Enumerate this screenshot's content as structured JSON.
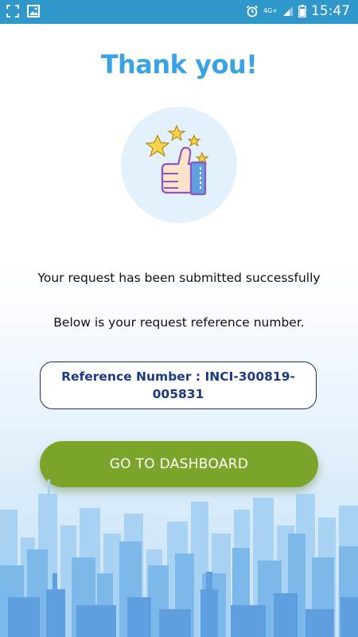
{
  "status_bar": {
    "time": "15:47",
    "network": "4G+",
    "left_icons": [
      "screenshot-icon",
      "image-icon"
    ],
    "right_icons": [
      "alarm-icon",
      "signal-icon",
      "battery-icon"
    ]
  },
  "page": {
    "title": "Thank you!",
    "hero_icon": "thumbs-up-stars-icon",
    "message_success": "Your request has been submitted successfully",
    "message_reference": "Below is your request reference number.",
    "reference_text": "Reference Number : INCI-300819-005831",
    "dashboard_button": "GO TO DASHBOARD"
  },
  "colors": {
    "status_bar": "#2f97c9",
    "title": "#3aa3e3",
    "reference_text": "#1b3a86",
    "button": "#7aa52a",
    "hero_circle": "#e3f1fc"
  }
}
